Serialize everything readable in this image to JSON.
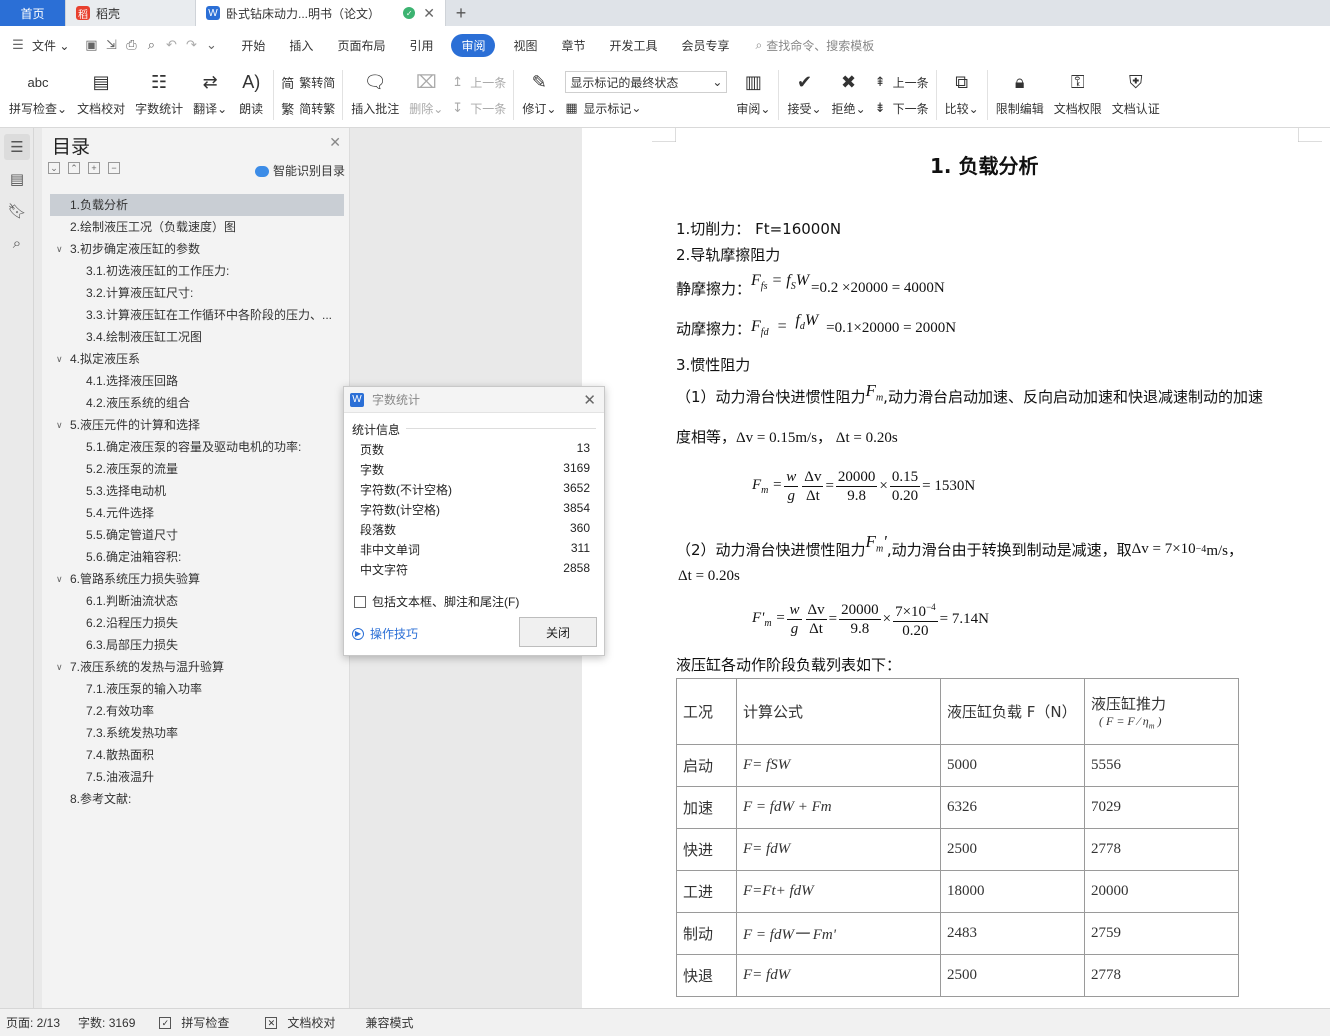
{
  "tabs": {
    "home": "首页",
    "daoke": "稻壳",
    "doc": "卧式钻床动力...明书（论文）",
    "new_tab": "+"
  },
  "menu": {
    "file": "文件",
    "items": [
      "开始",
      "插入",
      "页面布局",
      "引用",
      "审阅",
      "视图",
      "章节",
      "开发工具",
      "会员专享"
    ],
    "search_placeholder": "查找命令、搜索模板"
  },
  "ribbon": {
    "spell": "拼写检查",
    "proof": "文档校对",
    "wordcount": "字数统计",
    "translate": "翻译",
    "read": "朗读",
    "trad_simp": "繁转简",
    "simp_trad": "简转繁",
    "insert_comment": "插入批注",
    "delete": "删除",
    "prev": "上一条",
    "next": "下一条",
    "revise": "修订",
    "display_mode": "显示标记的最终状态",
    "show_markup": "显示标记",
    "review": "审阅",
    "accept": "接受",
    "reject": "拒绝",
    "prev2": "上一条",
    "next2": "下一条",
    "compare": "比较",
    "restrict": "限制编辑",
    "perm": "文档权限",
    "cert": "文档认证"
  },
  "nav": {
    "title": "目录",
    "smart": "智能识别目录",
    "items": [
      {
        "text": "1.负载分析",
        "level": 1,
        "selected": true,
        "arrow": ""
      },
      {
        "text": "2.绘制液压工况（负载速度）图",
        "level": 1,
        "arrow": ""
      },
      {
        "text": "3.初步确定液压缸的参数",
        "level": 1,
        "arrow": "∨"
      },
      {
        "text": "3.1.初选液压缸的工作压力:",
        "level": 2
      },
      {
        "text": "3.2.计算液压缸尺寸:",
        "level": 2
      },
      {
        "text": "3.3.计算液压缸在工作循环中各阶段的压力、...",
        "level": 2
      },
      {
        "text": "3.4.绘制液压缸工况图",
        "level": 2
      },
      {
        "text": "4.拟定液压系",
        "level": 1,
        "arrow": "∨"
      },
      {
        "text": "4.1.选择液压回路",
        "level": 2
      },
      {
        "text": "4.2.液压系统的组合",
        "level": 2
      },
      {
        "text": "5.液压元件的计算和选择",
        "level": 1,
        "arrow": "∨"
      },
      {
        "text": "5.1.确定液压泵的容量及驱动电机的功率:",
        "level": 2
      },
      {
        "text": "5.2.液压泵的流量",
        "level": 2
      },
      {
        "text": "5.3.选择电动机",
        "level": 2
      },
      {
        "text": "5.4.元件选择",
        "level": 2
      },
      {
        "text": "5.5.确定管道尺寸",
        "level": 2
      },
      {
        "text": "5.6.确定油箱容积:",
        "level": 2
      },
      {
        "text": "6.管路系统压力损失验算",
        "level": 1,
        "arrow": "∨"
      },
      {
        "text": "6.1.判断油流状态",
        "level": 2
      },
      {
        "text": "6.2.沿程压力损失",
        "level": 2
      },
      {
        "text": "6.3.局部压力损失",
        "level": 2
      },
      {
        "text": "7.液压系统的发热与温升验算",
        "level": 1,
        "arrow": "∨"
      },
      {
        "text": "7.1.液压泵的输入功率",
        "level": 2
      },
      {
        "text": "7.2.有效功率",
        "level": 2
      },
      {
        "text": "7.3.系统发热功率",
        "level": 2
      },
      {
        "text": "7.4.散热面积",
        "level": 2
      },
      {
        "text": "7.5.油液温升",
        "level": 2
      },
      {
        "text": "8.参考文献:",
        "level": 1,
        "arrow": ""
      }
    ]
  },
  "doc": {
    "heading": "1.  负载分析",
    "l1": "1.切削力：   Ft=16000N",
    "l2": "2.导轨摩擦阻力",
    "static_label": "静摩擦力：",
    "static_eq": "=0.2  ×20000 = 4000N",
    "dynamic_label": "动摩擦力：",
    "dynamic_eq": "=0.1×20000 = 2000N",
    "l3": "3.惯性阻力",
    "p1a": "（1）动力滑台快进惯性阻力",
    "p1b": ",动力滑台启动加速、反向启动加速和快退减速制动的加速",
    "p1c": "度相等，",
    "p1d": "Δv = 0.15m/s，  Δt = 0.20s",
    "eq1_res": "= 1530N",
    "p2a": "（2）动力滑台快进惯性阻力",
    "p2b": ",动力滑台由于转换到制动是减速，取",
    "p2c": "Δv = 7×10",
    "p2d": "m/s，",
    "p2e": "Δt = 0.20s",
    "eq2_res": "= 7.14N",
    "table_intro": "液压缸各动作阶段负载列表如下：",
    "table": {
      "headers": [
        "工况",
        "计算公式",
        "液压缸负载 F（N）",
        "液压缸推力"
      ],
      "rows": [
        [
          "启动",
          "F=  fSW",
          "5000",
          "5556"
        ],
        [
          "加速",
          "F = fdW  +  Fm",
          "6326",
          "7029"
        ],
        [
          "快进",
          "F= fdW",
          "2500",
          "2778"
        ],
        [
          "工进",
          "F=Ft+ fdW",
          "18000",
          "20000"
        ],
        [
          "制动",
          "F = fdW一   Fm'",
          "2483",
          "2759"
        ],
        [
          "快退",
          "F= fdW",
          "2500",
          "2778"
        ]
      ]
    }
  },
  "dialog": {
    "title": "字数统计",
    "section": "统计信息",
    "stats": [
      {
        "label": "页数",
        "value": "13"
      },
      {
        "label": "字数",
        "value": "3169"
      },
      {
        "label": "字符数(不计空格)",
        "value": "3652"
      },
      {
        "label": "字符数(计空格)",
        "value": "3854"
      },
      {
        "label": "段落数",
        "value": "360"
      },
      {
        "label": "非中文单词",
        "value": "311"
      },
      {
        "label": "中文字符",
        "value": "2858"
      }
    ],
    "include": "包括文本框、脚注和尾注(F)",
    "tips": "操作技巧",
    "close": "关闭"
  },
  "status": {
    "page": "页面: 2/13",
    "words": "字数: 3169",
    "spell": "拼写检查",
    "proof": "文档校对",
    "compat": "兼容模式"
  }
}
